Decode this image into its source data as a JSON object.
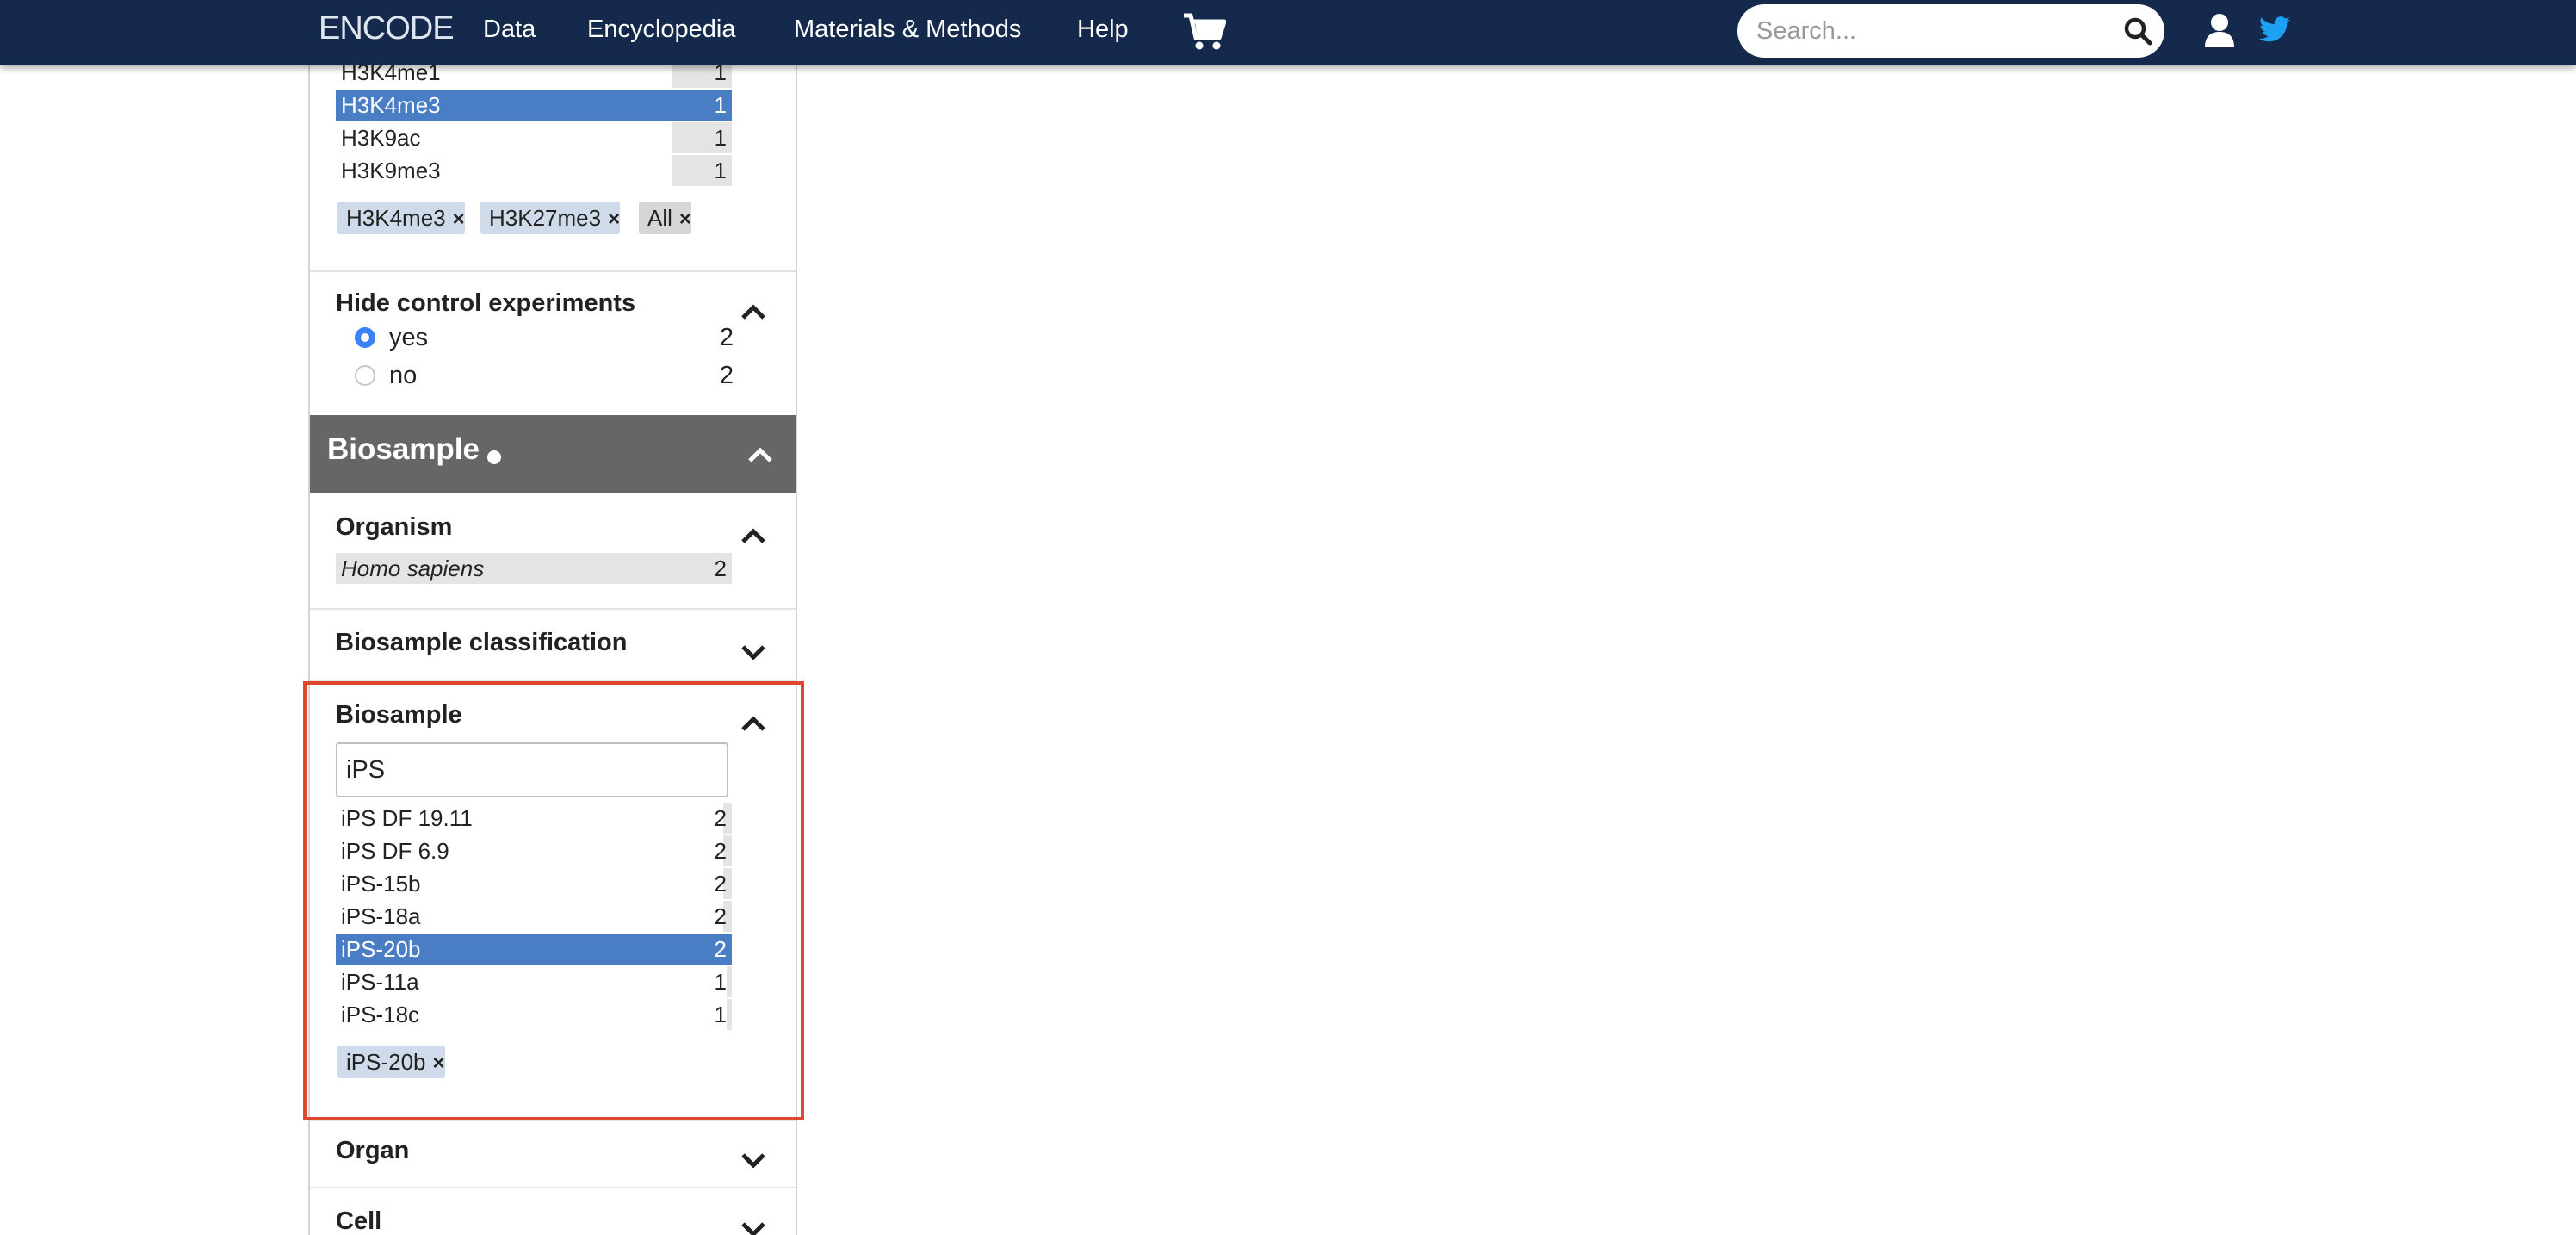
{
  "navbar": {
    "brand": "ENCODE",
    "items": [
      "Data",
      "Encyclopedia",
      "Materials & Methods",
      "Help"
    ],
    "search_placeholder": "Search..."
  },
  "histone_facet": {
    "terms": [
      {
        "label": "H3K4me1",
        "count": "1",
        "selected": false
      },
      {
        "label": "H3K4me3",
        "count": "1",
        "selected": true
      },
      {
        "label": "H3K9ac",
        "count": "1",
        "selected": false
      },
      {
        "label": "H3K9me3",
        "count": "1",
        "selected": false
      }
    ],
    "chips": [
      "H3K4me3",
      "H3K27me3",
      "All"
    ]
  },
  "hide_control": {
    "title": "Hide control experiments",
    "options": [
      {
        "label": "yes",
        "count": "2",
        "checked": true
      },
      {
        "label": "no",
        "count": "2",
        "checked": false
      }
    ]
  },
  "biosample_group": {
    "title": "Biosample"
  },
  "organism": {
    "title": "Organism",
    "terms": [
      {
        "label": "Homo sapiens",
        "count": "2"
      }
    ]
  },
  "biosample_classification": {
    "title": "Biosample classification"
  },
  "biosample": {
    "title": "Biosample",
    "search_value": "iPS",
    "terms": [
      {
        "label": "iPS DF 19.11",
        "count": "2",
        "selected": false
      },
      {
        "label": "iPS DF 6.9",
        "count": "2",
        "selected": false
      },
      {
        "label": "iPS-15b",
        "count": "2",
        "selected": false
      },
      {
        "label": "iPS-18a",
        "count": "2",
        "selected": false
      },
      {
        "label": "iPS-20b",
        "count": "2",
        "selected": true
      },
      {
        "label": "iPS-11a",
        "count": "1",
        "selected": false
      },
      {
        "label": "iPS-18c",
        "count": "1",
        "selected": false
      }
    ],
    "chips": [
      "iPS-20b"
    ]
  },
  "organ": {
    "title": "Organ"
  },
  "cell": {
    "title": "Cell"
  },
  "colors": {
    "navbar": "#14294b",
    "selected_term": "#4a7ec4",
    "group_header": "#666666",
    "highlight": "#e0472f",
    "chip": "#cfdbea"
  }
}
